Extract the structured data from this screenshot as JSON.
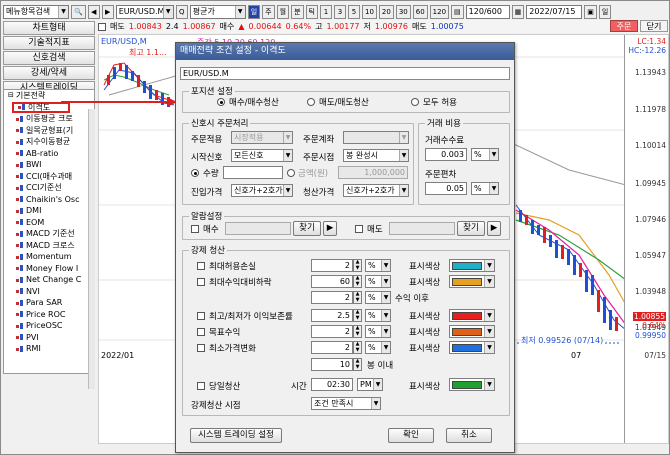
{
  "toolbar": {
    "search_placeholder": "메뉴항목검색",
    "symbol": "EUR/USD.M",
    "price_type": "평균가",
    "period_labels": [
      "일",
      "주",
      "월",
      "분",
      "틱"
    ],
    "minute_labels": [
      "1",
      "3",
      "5",
      "10",
      "20",
      "30",
      "60",
      "120"
    ],
    "count": "120/600",
    "date": "2022/07/15",
    "extra_label": "일"
  },
  "price_row": {
    "sell_label": "매도",
    "sell_price": "1.00843",
    "qty": "2.4",
    "buy_price": "1.00867",
    "buy_label": "매수",
    "change": "0.00644",
    "change_pct": "0.64%",
    "high_label": "고",
    "high": "1.00177",
    "low_label": "저",
    "low": "1.00976",
    "ask_label": "매도",
    "ask": "1.00075",
    "order_btn": "주문",
    "close_btn": "닫기"
  },
  "left_panel": {
    "buttons": [
      "차트형태",
      "기술적지표",
      "신호검색",
      "강세/약세",
      "시스템트레이딩"
    ],
    "tree_root": "기본전략",
    "tree_items": [
      "이격도",
      "이동평균 크로",
      "일목균형표(기",
      "지수이동평균",
      "AB-ratio",
      "BWI",
      "CCI(매수과매",
      "CCI기준선",
      "Chaikin's Osc",
      "DMI",
      "EOM",
      "MACD 기준선",
      "MACD 크로스",
      "Momentum",
      "Money Flow I",
      "Net Change C",
      "NVI",
      "Para SAR",
      "Price ROC",
      "PriceOSC",
      "PVI",
      "RMI"
    ]
  },
  "chart": {
    "symbol_label": "EUR/USD,M",
    "ma_legend": "중간 5 10 20 60 120",
    "high_marker": "최고 1.1...",
    "low_marker": "최저 0.99526 (07/14)",
    "lc": "LC:1.34",
    "hc": "HC:-12.26",
    "y_ticks": [
      "1.13943",
      "1.11978",
      "1.10014",
      "1.09945",
      "1.07946",
      "1.05947",
      "1.03948",
      "1.01949",
      "0.99950"
    ],
    "last_price": "1.00855",
    "last_pct": "0.64%",
    "x_start": "2022/01",
    "x_mid": "07",
    "x_end": "07/15"
  },
  "dialog": {
    "title": "매매전략 조건 설정 - 이격도",
    "symbol": "EUR/USD.M",
    "position": {
      "label": "포지션 설정",
      "options": [
        "매수/매수청산",
        "매도/매도청산",
        "모두 허용"
      ]
    },
    "signal": {
      "label": "신호시 주문처리",
      "order_apply_label": "주문적용",
      "order_apply_value": "시장적용",
      "order_cond_label": "주문계좌",
      "start_signal_label": "시작신호",
      "start_signal_value": "모든신호",
      "order_time_label": "주문시점",
      "order_time_value": "봉 완성시",
      "qty_label": "수량",
      "amount_label": "금액(원)",
      "amount_value": "1,000,000",
      "entry_label": "진입가격",
      "entry_value": "신호가+2호가",
      "exit_label": "청산가격",
      "exit_value": "신호가+2호가"
    },
    "trade_cost": {
      "label": "거래 비용",
      "fee_label": "거래수수료",
      "fee_value": "0.003",
      "fee_unit": "%",
      "slip_label": "주문편차",
      "slip_value": "0.05",
      "slip_unit": "%"
    },
    "alarm": {
      "label": "알람설정",
      "buy_label": "매수",
      "sell_label": "매도",
      "find_label": "찾기"
    },
    "force_exit": {
      "label": "강제 청산",
      "rows": [
        {
          "name": "최대허용손실",
          "value": "2",
          "unit": "%",
          "color_label": "표시색상",
          "color": "#20b0c8"
        },
        {
          "name": "최대수익대비하락",
          "value": "60",
          "unit": "%",
          "color_label": "표시색상",
          "color": "#e8a020"
        },
        {
          "name": "",
          "value": "2",
          "unit": "%",
          "suffix": "수익 이후"
        },
        {
          "name": "최고/최저가 이익보존률",
          "value": "2.5",
          "unit": "%",
          "color_label": "표시색상",
          "color": "#e82020"
        },
        {
          "name": "목표수익",
          "value": "2",
          "unit": "%",
          "color_label": "표시색상",
          "color": "#e06018"
        },
        {
          "name": "최소가격변화",
          "value": "2",
          "unit": "%",
          "color_label": "표시색상",
          "color": "#2070e0"
        },
        {
          "name": "",
          "value": "10",
          "suffix": "봉 이내"
        }
      ],
      "day_exit_label": "당일청산",
      "time_label": "시간",
      "time_value": "02:30",
      "ampm": "PM",
      "day_color_label": "표시색상",
      "day_color": "#20a030",
      "timing_label": "강제청산 시점",
      "timing_value": "조건 만족시"
    },
    "system_button": "시스템 트레이딩 설정",
    "ok_button": "확인",
    "cancel_button": "취소"
  }
}
